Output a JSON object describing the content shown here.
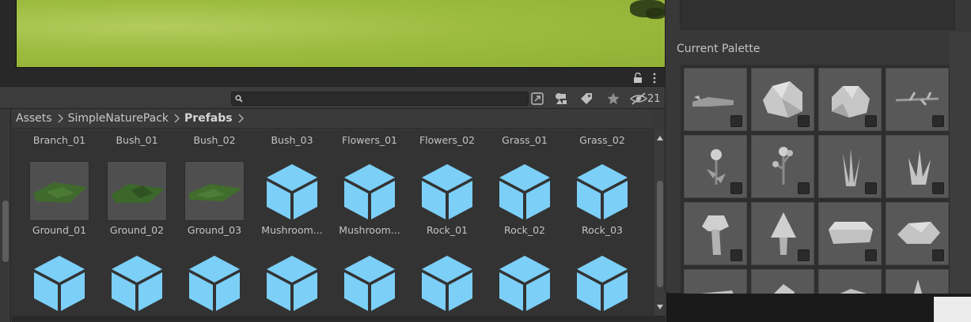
{
  "toolbar": {
    "search_value": "",
    "hidden_count": "21"
  },
  "breadcrumb": {
    "items": [
      "Assets",
      "SimpleNaturePack",
      "Prefabs"
    ]
  },
  "assets": {
    "row1_labels": [
      "Branch_01",
      "Bush_01",
      "Bush_02",
      "Bush_03",
      "Flowers_01",
      "Flowers_02",
      "Grass_01",
      "Grass_02"
    ],
    "row2_labels": [
      "Ground_01",
      "Ground_02",
      "Ground_03",
      "Mushroom...",
      "Mushroom...",
      "Rock_01",
      "Rock_02",
      "Rock_03"
    ]
  },
  "palette": {
    "title": "Current Palette"
  },
  "colors": {
    "prefab_cube": "#7ccff7",
    "scene_ground": "#9cbc3f"
  },
  "icons": [
    "lock-icon",
    "menu-icon",
    "search-icon",
    "object-picker-icon",
    "filter-type-icon",
    "label-icon",
    "favorite-star-icon",
    "hidden-packages-icon",
    "chevron-right-icon",
    "prefab-cube-icon",
    "arrow-up-icon",
    "arrow-down-icon"
  ]
}
